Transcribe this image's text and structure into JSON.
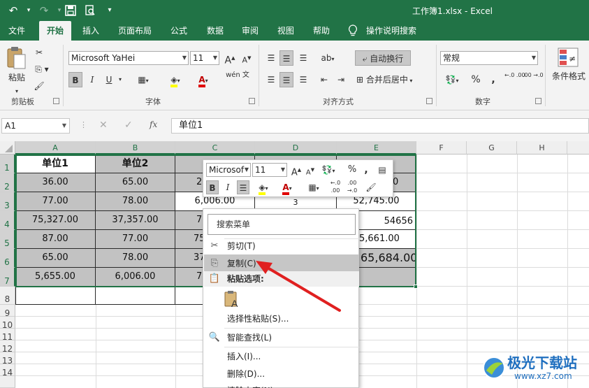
{
  "window": {
    "title": "工作簿1.xlsx  -  Excel"
  },
  "qat": {
    "more": "▾"
  },
  "tabs": [
    "文件",
    "开始",
    "插入",
    "页面布局",
    "公式",
    "数据",
    "审阅",
    "视图",
    "帮助",
    "操作说明搜索"
  ],
  "ribbon": {
    "clipboard": {
      "paste": "粘贴",
      "label": "剪贴板"
    },
    "font": {
      "name": "Microsoft YaHei",
      "size": "11",
      "bold": "B",
      "italic": "I",
      "underline": "U",
      "label": "字体",
      "wen": "wén 文"
    },
    "alignment": {
      "wrap": "自动换行",
      "merge": "合并后居中",
      "label": "对齐方式"
    },
    "number": {
      "format": "常规",
      "percent": "%",
      "comma": ",",
      "label": "数字",
      "inc": "←.0 .00",
      "dec": ".00 →.0"
    },
    "styles": {
      "conditional": "条件格式"
    }
  },
  "formula_bar": {
    "name_box": "A1",
    "fx": "fx",
    "value": "单位1"
  },
  "columns": [
    "A",
    "B",
    "C",
    "D",
    "E",
    "F",
    "G",
    "H"
  ],
  "rows": [
    "1",
    "2",
    "3",
    "4",
    "5",
    "6",
    "7",
    "8",
    "9",
    "10",
    "11",
    "12",
    "13",
    "14"
  ],
  "cells": {
    "A1": "单位1",
    "B1": "单位2",
    "A2": "36.00",
    "B2": "65.00",
    "C2": "2,",
    "E2": "0",
    "A3": "77.00",
    "B3": "78.00",
    "C3": "6,006.00",
    "D3": "3",
    "E3": "52,745.00",
    "A4": "75,327.00",
    "B4": "37,357.00",
    "C4": "7,",
    "E4": "54656",
    "A5": "87.00",
    "B5": "77.00",
    "C5": "75",
    "E5": "5,661.00",
    "A6": "65.00",
    "B6": "78.00",
    "C6": "37",
    "E6": "65,684.00",
    "A7": "5,655.00",
    "B7": "6,006.00",
    "C7": "7,"
  },
  "mini_toolbar": {
    "font": "Microsof",
    "size": "11",
    "bold": "B",
    "italic": "I",
    "percent": "%",
    "comma": ","
  },
  "context_menu": {
    "search": "搜索菜单",
    "items": [
      {
        "label": "剪切(T)",
        "icon": "scissors-icon"
      },
      {
        "label": "复制(C)",
        "icon": "copy-icon"
      },
      {
        "label": "粘贴选项:",
        "icon": "paste-icon"
      },
      {
        "label": "选择性粘贴(S)...",
        "icon": ""
      },
      {
        "label": "智能查找(L)",
        "icon": "smart-lookup-icon"
      },
      {
        "label": "插入(I)...",
        "icon": ""
      },
      {
        "label": "删除(D)...",
        "icon": ""
      },
      {
        "label": "清除内容(N)",
        "icon": ""
      }
    ]
  },
  "watermark": {
    "text": "极光下载站",
    "url": "www.xz7.com"
  },
  "colors": {
    "excel_green": "#217346",
    "arrow": "#e02020"
  }
}
